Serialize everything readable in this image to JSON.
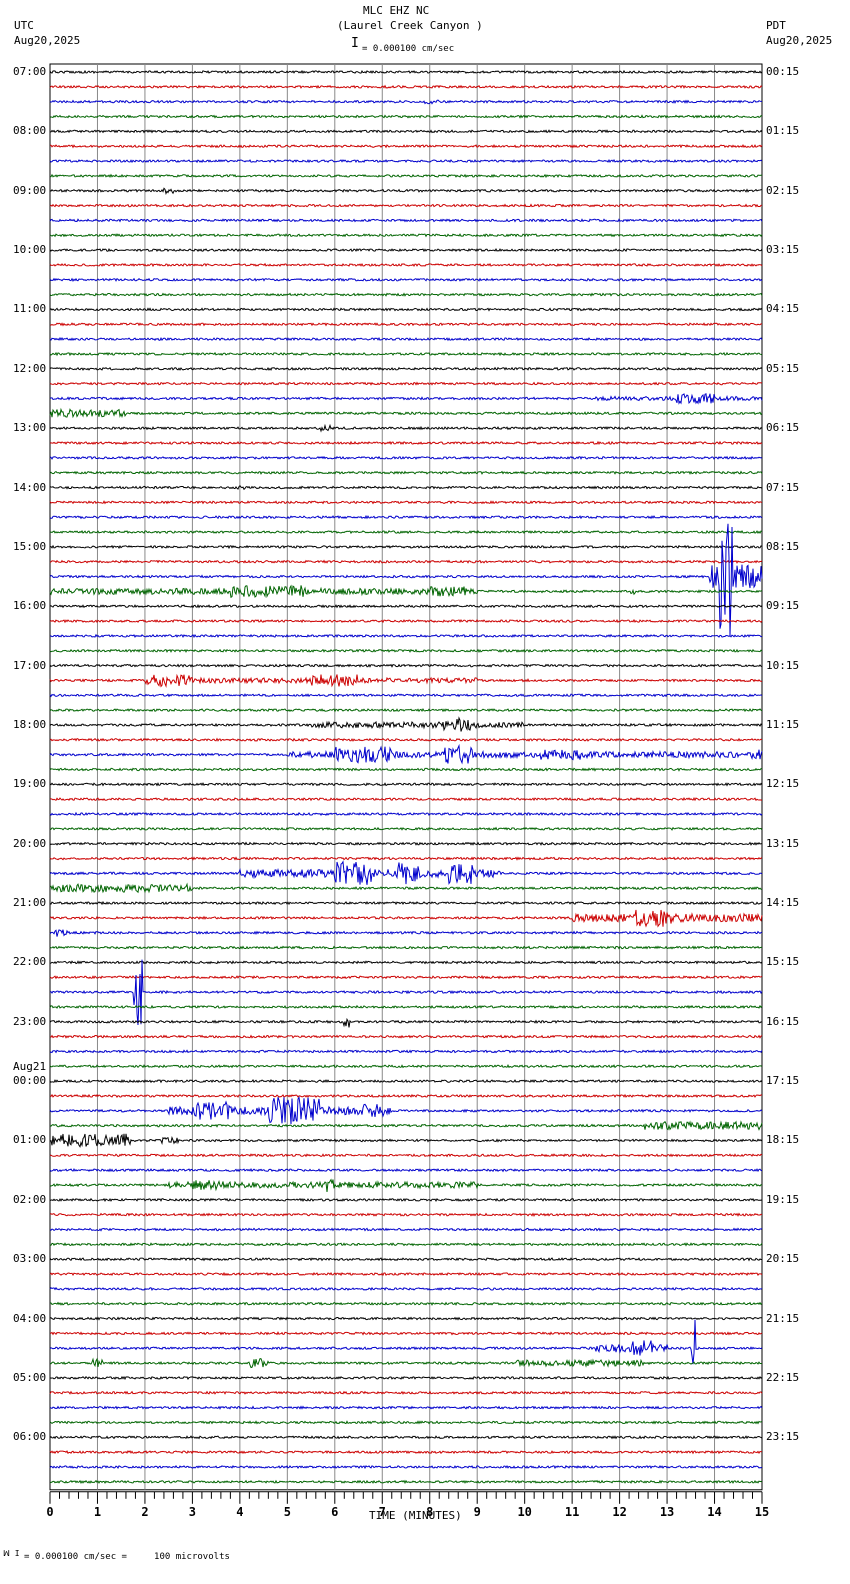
{
  "header": {
    "title": "MLC EHZ NC",
    "subtitle": "(Laurel Creek Canyon )",
    "left_tz": "UTC",
    "left_date": "Aug20,2025",
    "right_tz": "PDT",
    "right_date": "Aug20,2025",
    "scale_text": "= 0.000100 cm/sec"
  },
  "footer": {
    "scale_text": "= 0.000100 cm/sec =     100 microvolts"
  },
  "chart_data": {
    "type": "line",
    "title": "MLC EHZ NC (Laurel Creek Canyon )",
    "xlabel": "TIME (MINUTES)",
    "xlim": [
      0,
      15
    ],
    "x_ticks": [
      "0",
      "1",
      "2",
      "3",
      "4",
      "5",
      "6",
      "7",
      "8",
      "9",
      "10",
      "11",
      "12",
      "13",
      "14",
      "15"
    ],
    "traces_per_hour": 4,
    "trace_count": 96,
    "trace_colors": [
      "#000000",
      "#cc0000",
      "#0000cc",
      "#006400"
    ],
    "date_change_label": "Aug21",
    "left_labels": [
      "07:00",
      "08:00",
      "09:00",
      "10:00",
      "11:00",
      "12:00",
      "13:00",
      "14:00",
      "15:00",
      "16:00",
      "17:00",
      "18:00",
      "19:00",
      "20:00",
      "21:00",
      "22:00",
      "23:00",
      "00:00",
      "01:00",
      "02:00",
      "03:00",
      "04:00",
      "05:00",
      "06:00"
    ],
    "right_labels": [
      "00:15",
      "01:15",
      "02:15",
      "03:15",
      "04:15",
      "05:15",
      "06:15",
      "07:15",
      "08:15",
      "09:15",
      "10:15",
      "11:15",
      "12:15",
      "13:15",
      "14:15",
      "15:15",
      "16:15",
      "17:15",
      "18:15",
      "19:15",
      "20:15",
      "21:15",
      "22:15",
      "23:15"
    ],
    "events": [
      {
        "trace": 2,
        "start": 7.9,
        "end": 8.2,
        "amp": 2
      },
      {
        "trace": 8,
        "start": 2.4,
        "end": 2.6,
        "amp": 3
      },
      {
        "trace": 22,
        "start": 11.5,
        "end": 15,
        "amp": 2
      },
      {
        "trace": 22,
        "start": 13.2,
        "end": 14.0,
        "amp": 5
      },
      {
        "trace": 23,
        "start": 0,
        "end": 1.6,
        "amp": 4
      },
      {
        "trace": 24,
        "start": 5.7,
        "end": 5.9,
        "amp": 3
      },
      {
        "trace": 28,
        "start": 3.95,
        "end": 4.1,
        "amp": 3
      },
      {
        "trace": 34,
        "start": 13.9,
        "end": 15,
        "amp": 12
      },
      {
        "trace": 34,
        "start": 14.1,
        "end": 14.4,
        "amp": 60
      },
      {
        "trace": 35,
        "start": 0,
        "end": 9,
        "amp": 3
      },
      {
        "trace": 35,
        "start": 3.8,
        "end": 5.5,
        "amp": 6
      },
      {
        "trace": 35,
        "start": 8,
        "end": 8.8,
        "amp": 5
      },
      {
        "trace": 35,
        "start": 12.2,
        "end": 12.4,
        "amp": 3
      },
      {
        "trace": 41,
        "start": 2,
        "end": 3,
        "amp": 6
      },
      {
        "trace": 41,
        "start": 5.5,
        "end": 6.5,
        "amp": 6
      },
      {
        "trace": 41,
        "start": 3,
        "end": 9,
        "amp": 2.5
      },
      {
        "trace": 44,
        "start": 5.5,
        "end": 10,
        "amp": 3
      },
      {
        "trace": 44,
        "start": 8.3,
        "end": 8.9,
        "amp": 7
      },
      {
        "trace": 46,
        "start": 5,
        "end": 14.5,
        "amp": 3
      },
      {
        "trace": 46,
        "start": 6,
        "end": 7.2,
        "amp": 8
      },
      {
        "trace": 46,
        "start": 8.3,
        "end": 8.9,
        "amp": 9
      },
      {
        "trace": 46,
        "start": 10.3,
        "end": 11.2,
        "amp": 5
      },
      {
        "trace": 46,
        "start": 14.7,
        "end": 15,
        "amp": 5
      },
      {
        "trace": 54,
        "start": 4,
        "end": 9.5,
        "amp": 4
      },
      {
        "trace": 54,
        "start": 6,
        "end": 6.8,
        "amp": 12
      },
      {
        "trace": 54,
        "start": 7.3,
        "end": 7.8,
        "amp": 11
      },
      {
        "trace": 54,
        "start": 8.4,
        "end": 8.9,
        "amp": 11
      },
      {
        "trace": 55,
        "start": 0,
        "end": 3,
        "amp": 4
      },
      {
        "trace": 57,
        "start": 11,
        "end": 15,
        "amp": 4
      },
      {
        "trace": 57,
        "start": 12.3,
        "end": 13.1,
        "amp": 9
      },
      {
        "trace": 58,
        "start": 0.1,
        "end": 0.4,
        "amp": 4
      },
      {
        "trace": 62,
        "start": 1.75,
        "end": 1.95,
        "amp": 35
      },
      {
        "trace": 64,
        "start": 6.15,
        "end": 6.3,
        "amp": 6
      },
      {
        "trace": 70,
        "start": 2.5,
        "end": 7.2,
        "amp": 4
      },
      {
        "trace": 70,
        "start": 3,
        "end": 3.8,
        "amp": 9
      },
      {
        "trace": 70,
        "start": 4.6,
        "end": 5.7,
        "amp": 14
      },
      {
        "trace": 70,
        "start": 6.6,
        "end": 7.1,
        "amp": 7
      },
      {
        "trace": 71,
        "start": 12.5,
        "end": 15,
        "amp": 4
      },
      {
        "trace": 72,
        "start": 0,
        "end": 1.7,
        "amp": 7
      },
      {
        "trace": 72,
        "start": 2.3,
        "end": 2.7,
        "amp": 3
      },
      {
        "trace": 75,
        "start": 2.5,
        "end": 9,
        "amp": 3
      },
      {
        "trace": 75,
        "start": 3,
        "end": 3.8,
        "amp": 5
      },
      {
        "trace": 75,
        "start": 5.8,
        "end": 6,
        "amp": 7
      },
      {
        "trace": 86,
        "start": 11.5,
        "end": 13,
        "amp": 4
      },
      {
        "trace": 86,
        "start": 12.2,
        "end": 12.7,
        "amp": 8
      },
      {
        "trace": 86,
        "start": 13.5,
        "end": 13.6,
        "amp": 30
      },
      {
        "trace": 87,
        "start": 0.9,
        "end": 1.1,
        "amp": 4
      },
      {
        "trace": 87,
        "start": 4.2,
        "end": 4.6,
        "amp": 5
      },
      {
        "trace": 87,
        "start": 9.8,
        "end": 12.5,
        "amp": 3
      }
    ]
  }
}
